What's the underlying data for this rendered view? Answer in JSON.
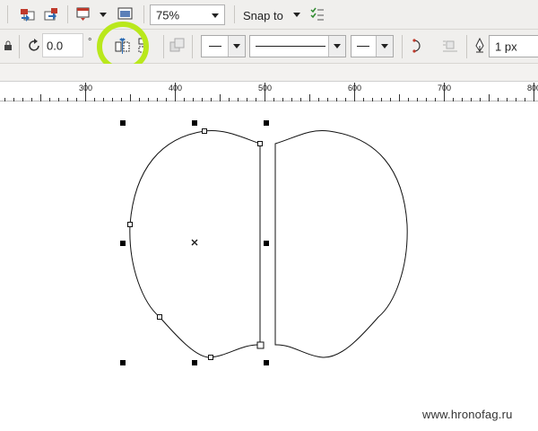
{
  "toolbar1": {
    "zoom_value": "75%",
    "snap_label": "Snap to"
  },
  "toolbar2": {
    "rotation_value": "0.0",
    "degree_symbol": "°",
    "outline_width": "1 px"
  },
  "ruler": {
    "labels": [
      "300",
      "400",
      "500",
      "600",
      "700",
      "800"
    ]
  },
  "watermark": "www.hronofag.ru",
  "colors": {
    "highlight_ring": "#b9e81c",
    "toolbar_bg": "#f0efed"
  }
}
